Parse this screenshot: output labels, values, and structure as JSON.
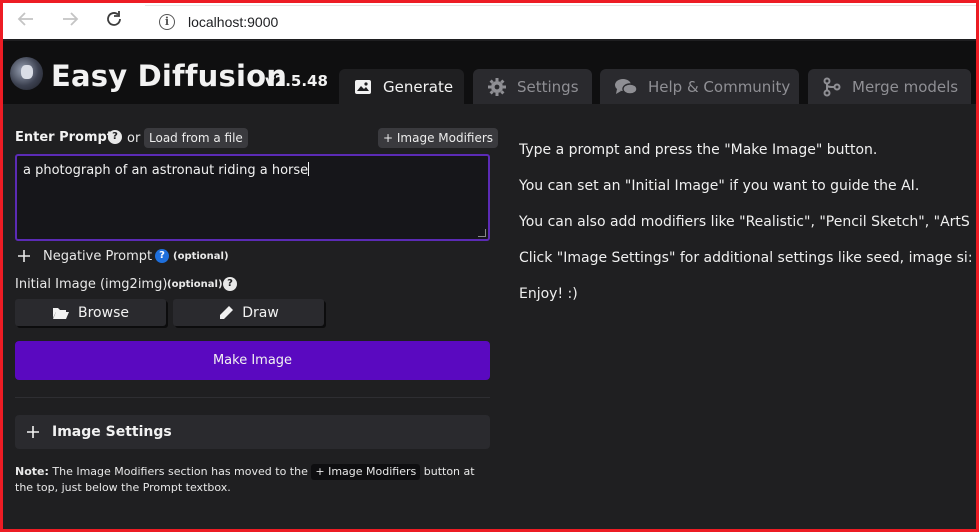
{
  "browser": {
    "url": "localhost:9000",
    "back_icon": "arrow-left-icon",
    "forward_icon": "arrow-right-icon",
    "reload_icon": "reload-icon",
    "info_icon": "info-icon"
  },
  "app": {
    "title": "Easy Diffusion",
    "version": "v2.5.48"
  },
  "tabs": [
    {
      "label": "Generate",
      "icon": "image-icon",
      "active": true
    },
    {
      "label": "Settings",
      "icon": "gear-icon",
      "active": false
    },
    {
      "label": "Help & Community",
      "icon": "chat-icon",
      "active": false
    },
    {
      "label": "Merge models",
      "icon": "merge-icon",
      "active": false
    }
  ],
  "prompt": {
    "label": "Enter Prompt",
    "or_text": "or",
    "load_file_label": "Load from a file",
    "image_modifiers_label": "+ Image Modifiers",
    "value": "a photograph of an astronaut riding a horse"
  },
  "negative_prompt": {
    "label": "Negative Prompt",
    "optional": "(optional)"
  },
  "initial_image": {
    "label": "Initial Image (img2img)",
    "optional": "(optional)",
    "browse_label": "Browse",
    "draw_label": "Draw"
  },
  "make_image_label": "Make Image",
  "image_settings_label": "Image Settings",
  "note": {
    "prefix": "Note:",
    "text_before": "The Image Modifiers section has moved to the",
    "chip": "+ Image Modifiers",
    "text_after": "button at the top, just below the Prompt textbox."
  },
  "instructions": [
    "Type a prompt and press the \"Make Image\" button.",
    "You can set an \"Initial Image\" if you want to guide the AI.",
    "You can also add modifiers like \"Realistic\", \"Pencil Sketch\", \"ArtS",
    "Click \"Image Settings\" for additional settings like seed, image si:",
    "Enjoy! :)"
  ],
  "colors": {
    "accent_purple": "#5a09c0",
    "prompt_border": "#5b2bb5",
    "background": "#1f1f21",
    "header": "#0f0f10",
    "frame_border": "#ed1c24"
  }
}
